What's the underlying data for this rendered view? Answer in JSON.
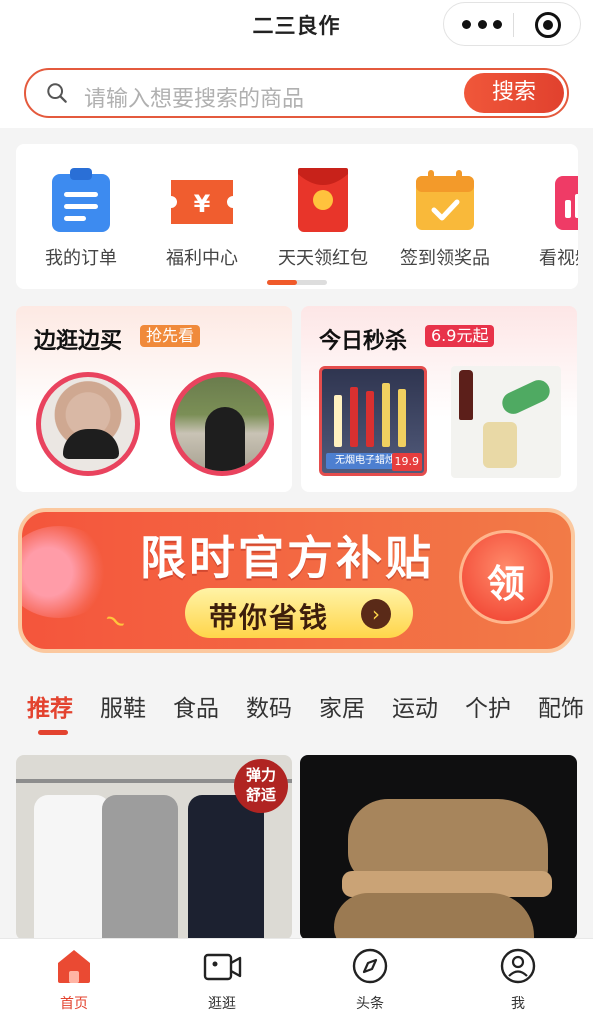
{
  "header": {
    "title": "二三良作"
  },
  "search": {
    "placeholder": "请输入想要搜索的商品",
    "button_label": "搜索"
  },
  "quick_menu": [
    {
      "label": "我的订单",
      "icon": "clipboard-icon"
    },
    {
      "label": "福利中心",
      "icon": "coupon-icon"
    },
    {
      "label": "天天领红包",
      "icon": "red-envelope-icon"
    },
    {
      "label": "签到领奖品",
      "icon": "calendar-check-icon"
    },
    {
      "label": "看视频",
      "icon": "video-chart-icon"
    }
  ],
  "promo": {
    "left": {
      "title": "边逛边买",
      "tag": "抢先看"
    },
    "right": {
      "title": "今日秒杀",
      "tag": "6.9元起",
      "candle_text": "无烟电子蜡烛",
      "candle_price": "19.9"
    }
  },
  "banner": {
    "title": "限时官方补贴",
    "subtitle": "带你省钱",
    "claim": "领"
  },
  "categories": [
    "推荐",
    "服鞋",
    "食品",
    "数码",
    "家居",
    "运动",
    "个护",
    "配饰"
  ],
  "products": [
    {
      "badge_line1": "弹力",
      "badge_line2": "舒适"
    },
    {}
  ],
  "bottom_nav": [
    {
      "label": "首页",
      "icon": "home-icon",
      "active": true
    },
    {
      "label": "逛逛",
      "icon": "video-camera-icon"
    },
    {
      "label": "头条",
      "icon": "compass-icon"
    },
    {
      "label": "我",
      "icon": "user-icon"
    }
  ],
  "colors": {
    "accent": "#e3432f",
    "search_border": "#e45a3d",
    "banner_bg": "#f4553c",
    "pill": "#ffd54a"
  }
}
